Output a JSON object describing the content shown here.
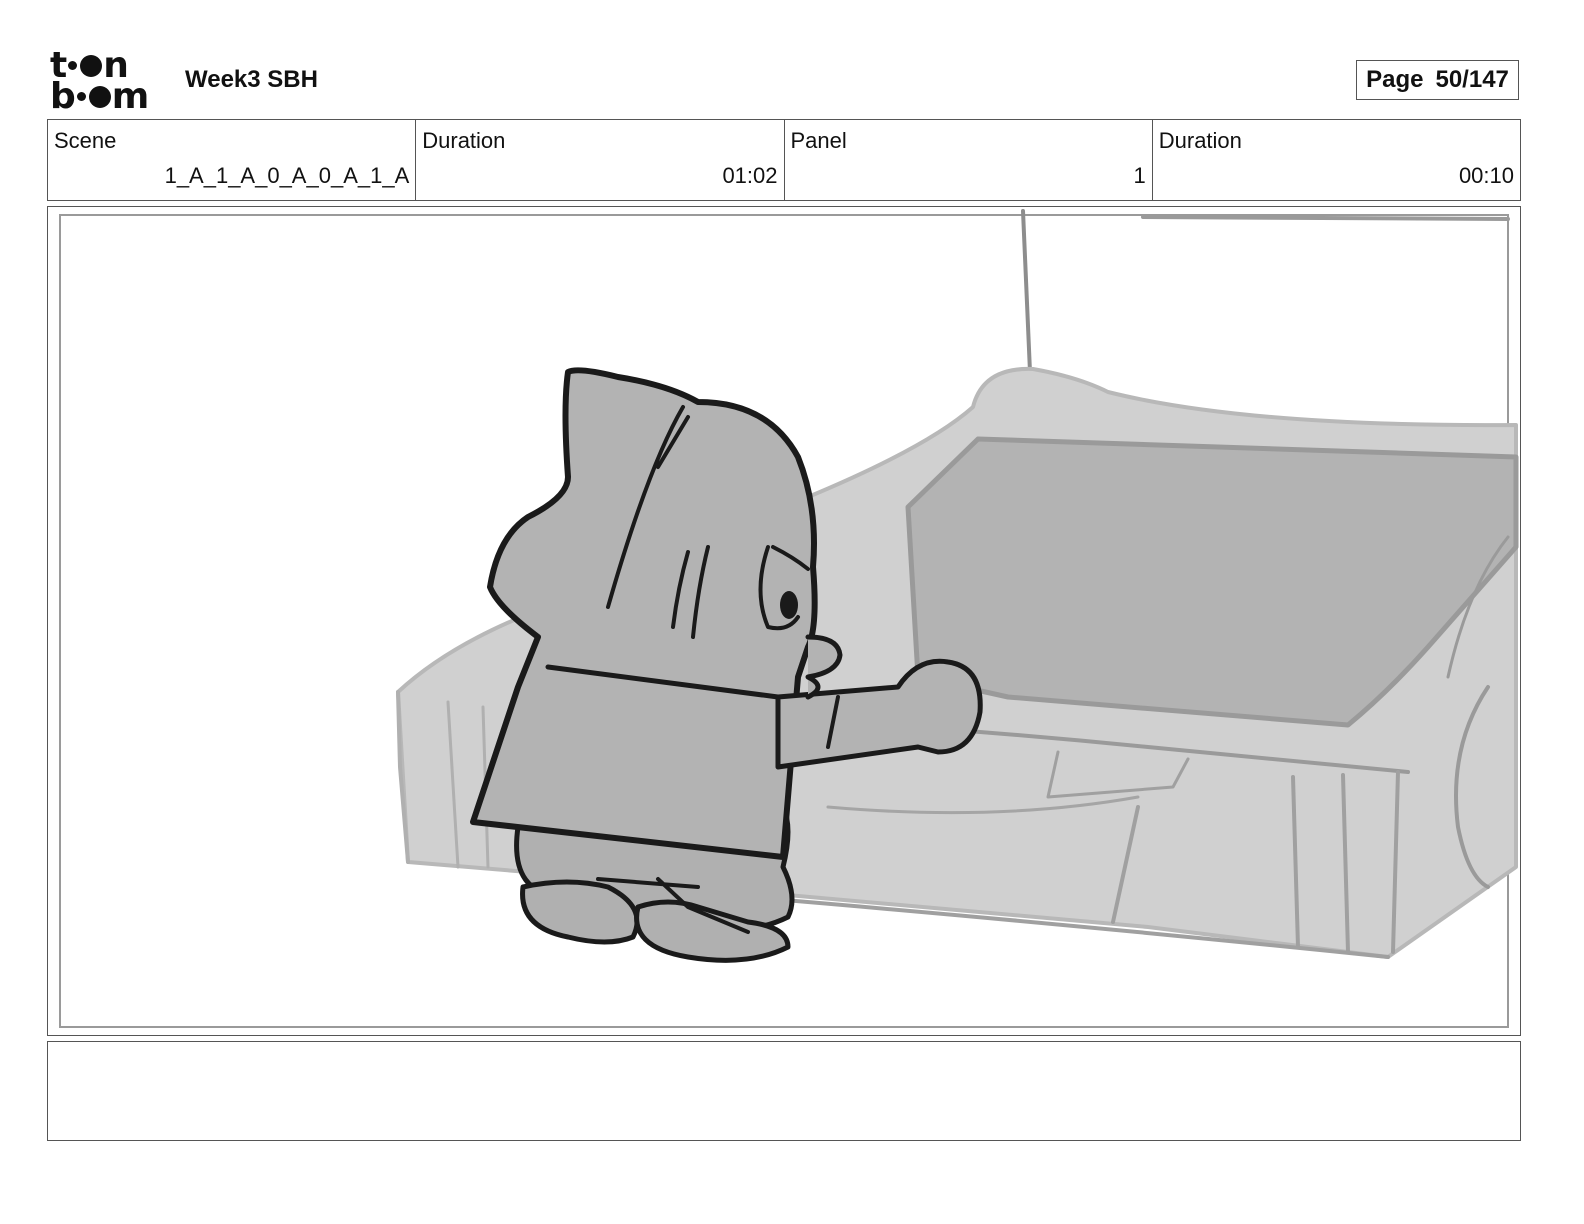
{
  "header": {
    "logo_top": "t•●n",
    "logo_bottom": "b•●m",
    "project_title": "Week3 SBH",
    "page_label": "Page",
    "page_number": "50/147"
  },
  "info": {
    "scene_label": "Scene",
    "scene_value": "1_A_1_A_0_A_0_A_1_A",
    "scene_duration_label": "Duration",
    "scene_duration_value": "01:02",
    "panel_label": "Panel",
    "panel_value": "1",
    "panel_duration_label": "Duration",
    "panel_duration_value": "00:10"
  },
  "notes": {
    "text": ""
  },
  "colors": {
    "border": "#555555",
    "sketch_light": "#cfcfcf",
    "sketch_mid": "#b3b3b3",
    "ink": "#1a1a1a"
  }
}
